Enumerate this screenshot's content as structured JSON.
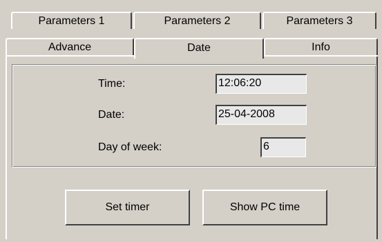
{
  "tabs": {
    "row1": [
      "Parameters 1",
      "Parameters 2",
      "Parameters 3"
    ],
    "row2": [
      "Advance",
      "Date",
      "Info"
    ],
    "selected": "Date"
  },
  "form": {
    "time_label": "Time:",
    "time_value": "12:06:20",
    "date_label": "Date:",
    "date_value": "25-04-2008",
    "dow_label": "Day of week:",
    "dow_value": "6"
  },
  "buttons": {
    "set_timer": "Set timer",
    "show_pc_time": "Show PC time"
  },
  "colors": {
    "window_bg": "#d4d0c8",
    "field_bg": "#e8e8e8"
  }
}
